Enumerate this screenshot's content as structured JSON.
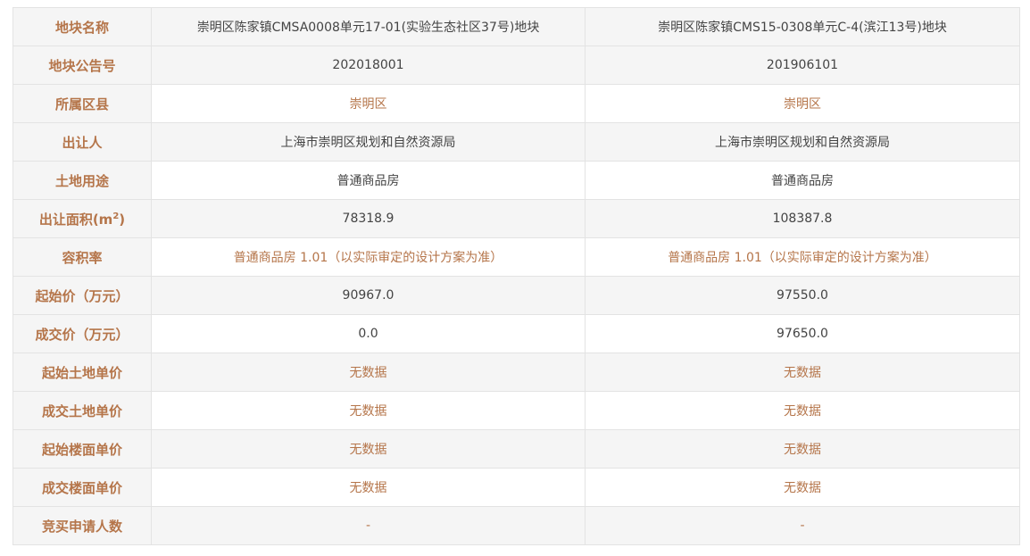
{
  "colors": {
    "label_text": "#b5754a",
    "value_text": "#444444",
    "accent_text": "#b5754a",
    "label_bg": "#f5f5f5",
    "border": "#e3e3e3"
  },
  "rows": [
    {
      "label": "地块名称",
      "a": "崇明区陈家镇CMSA0008单元17-01(实验生态社区37号)地块",
      "b": "崇明区陈家镇CMS15-0308单元C-4(滨江13号)地块"
    },
    {
      "label": "地块公告号",
      "a": "202018001",
      "b": "201906101"
    },
    {
      "label": "所属区县",
      "a": "崇明区",
      "b": "崇明区"
    },
    {
      "label": "出让人",
      "a": "上海市崇明区规划和自然资源局",
      "b": "上海市崇明区规划和自然资源局"
    },
    {
      "label": "土地用途",
      "a": "普通商品房",
      "b": "普通商品房"
    },
    {
      "label_main": "出让面积(m",
      "label_sup": "2",
      "label_end": ")",
      "a": "78318.9",
      "b": "108387.8"
    },
    {
      "label": "容积率",
      "a": "普通商品房 1.01（以实际审定的设计方案为准）",
      "b": "普通商品房 1.01（以实际审定的设计方案为准）"
    },
    {
      "label": "起始价（万元）",
      "a": "90967.0",
      "b": "97550.0"
    },
    {
      "label": "成交价（万元）",
      "a": "0.0",
      "b": "97650.0"
    },
    {
      "label": "起始土地单价",
      "a": "无数据",
      "b": "无数据"
    },
    {
      "label": "成交土地单价",
      "a": "无数据",
      "b": "无数据"
    },
    {
      "label": "起始楼面单价",
      "a": "无数据",
      "b": "无数据"
    },
    {
      "label": "成交楼面单价",
      "a": "无数据",
      "b": "无数据"
    },
    {
      "label": "竞买申请人数",
      "a": "-",
      "b": "-"
    }
  ]
}
